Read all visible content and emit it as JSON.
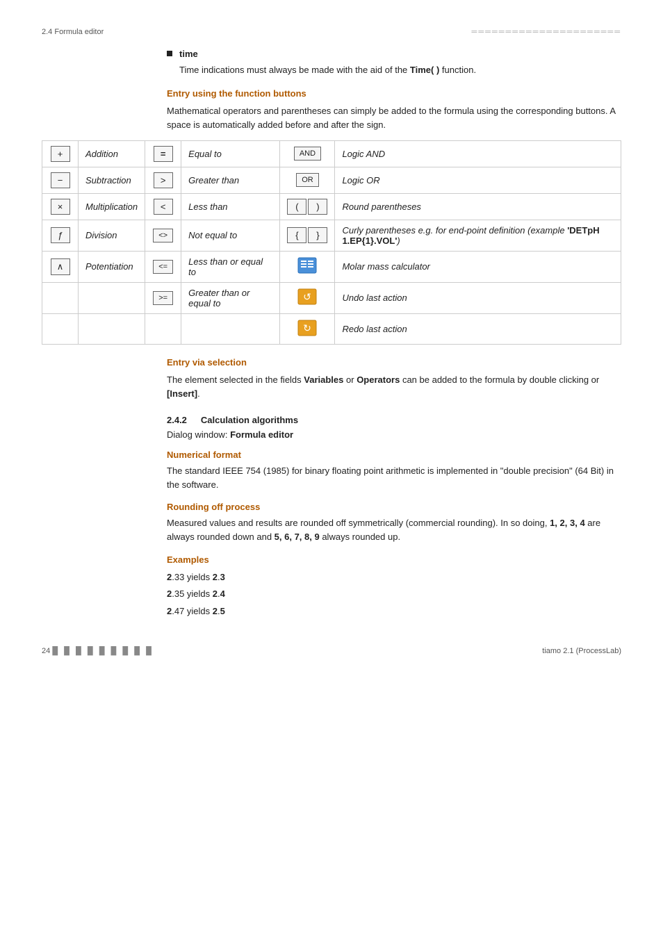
{
  "header": {
    "left": "2.4 Formula editor",
    "right_dots": "═══════════════════════"
  },
  "bullet_time": {
    "label": "time",
    "description": "Time indications must always be made with the aid of the Time( ) function."
  },
  "entry_functions": {
    "heading": "Entry using the function buttons",
    "description": "Mathematical operators and parentheses can simply be added to the formula using the corresponding buttons. A space is automatically added before and after the sign."
  },
  "table": {
    "rows": [
      {
        "btn1_symbol": "+",
        "desc1": "Addition",
        "btn2_symbol": "=",
        "desc2": "Equal to",
        "btn3_symbol": "AND",
        "desc3": "Logic AND"
      },
      {
        "btn1_symbol": "−",
        "desc1": "Subtraction",
        "btn2_symbol": ">",
        "desc2": "Greater than",
        "btn3_symbol": "OR",
        "desc3": "Logic OR"
      },
      {
        "btn1_symbol": "×",
        "desc1": "Multiplication",
        "btn2_symbol": "<",
        "desc2": "Less than",
        "btn3_symbol": "( )",
        "desc3": "Round parentheses"
      },
      {
        "btn1_symbol": "ƒ",
        "desc1": "Division",
        "btn2_symbol": "<>",
        "desc2": "Not equal to",
        "btn3_symbol": "{ }",
        "desc3": "Curly parentheses e.g. for end-point definition (example 'DETpH 1.EP{1}.VOL')"
      },
      {
        "btn1_symbol": "∧",
        "desc1": "Potentiation",
        "btn2_symbol": "<=",
        "desc2": "Less than or equal to",
        "btn3_symbol": "molar",
        "desc3": "Molar mass calculator"
      },
      {
        "btn1_symbol": "",
        "desc1": "",
        "btn2_symbol": ">=",
        "desc2": "Greater than or equal to",
        "btn3_symbol": "undo",
        "desc3": "Undo last action"
      },
      {
        "btn1_symbol": "",
        "desc1": "",
        "btn2_symbol": "",
        "desc2": "",
        "btn3_symbol": "redo",
        "desc3": "Redo last action"
      }
    ]
  },
  "entry_selection": {
    "heading": "Entry via selection",
    "description": "The element selected in the fields Variables or Operators can be added to the formula by double clicking or [Insert]."
  },
  "section_242": {
    "number": "2.4.2",
    "title": "Calculation algorithms",
    "dialog_label": "Dialog window:",
    "dialog_value": "Formula editor"
  },
  "numerical_format": {
    "heading": "Numerical format",
    "description": "The standard IEEE 754 (1985) for binary floating point arithmetic is implemented in \"double precision\" (64 Bit) in the software."
  },
  "rounding": {
    "heading": "Rounding off process",
    "description_1": "Measured values and results are rounded off symmetrically (commercial rounding). In so doing,",
    "bold_down": "1, 2, 3, 4",
    "description_2": "are always rounded down and",
    "bold_up": "5, 6, 7, 8, 9",
    "description_3": "always rounded up.",
    "examples_heading": "Examples",
    "examples": [
      {
        "val": "2.33",
        "yields": "yields",
        "result": "2.3"
      },
      {
        "val": "2.35",
        "yields": "yields",
        "result": "2.4"
      },
      {
        "val": "2.47",
        "yields": "yields",
        "result": "2.5"
      }
    ]
  },
  "footer": {
    "page": "24",
    "dots": "█ █ █ █ █ █ █ █ █",
    "product": "tiamo 2.1 (ProcessLab)"
  }
}
